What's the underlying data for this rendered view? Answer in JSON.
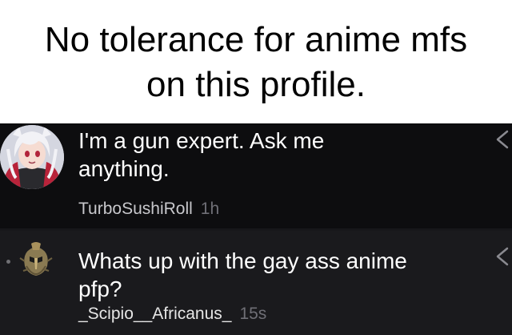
{
  "caption": {
    "line1": "No tolerance for anime mfs",
    "line2": "on this profile."
  },
  "comments": [
    {
      "text": "I'm a gun expert. Ask me anything.",
      "username": "TurboSushiRoll",
      "time": "1h",
      "avatar_icon": "anime-girl-avatar-icon"
    },
    {
      "text": "Whats up with the gay ass anime pfp?",
      "username": "_Scipio__Africanus_",
      "time": "15s",
      "avatar_icon": "roman-helmet-avatar-icon"
    }
  ],
  "colors": {
    "thread_bg": "#0e0e10",
    "highlight_bg": "#1a1a1d",
    "text": "#ffffff",
    "muted": "#6f6f76"
  }
}
